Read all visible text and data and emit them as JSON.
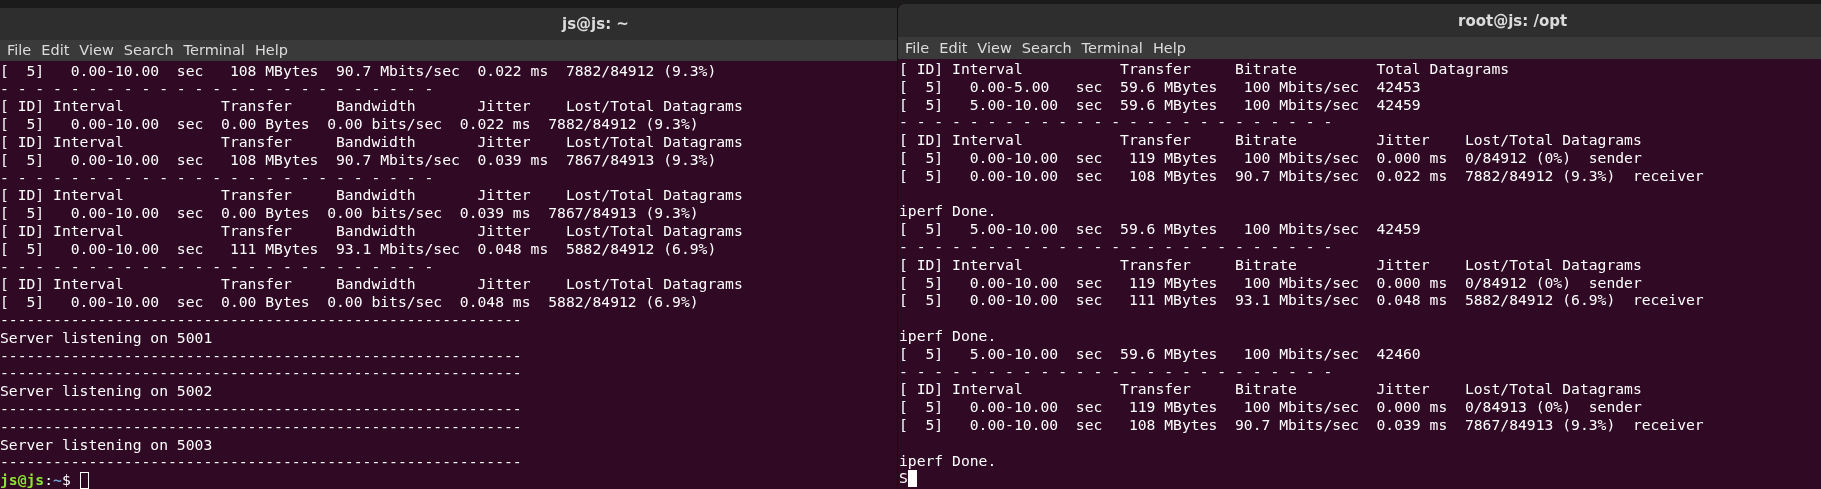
{
  "windows": [
    {
      "title": "js@js: ~",
      "menu": [
        "File",
        "Edit",
        "View",
        "Search",
        "Terminal",
        "Help"
      ],
      "lines": [
        {
          "kind": "text",
          "text": "[  5]   0.00-10.00  sec   108 MBytes  90.7 Mbits/sec  0.022 ms  7882/84912 (9.3%)"
        },
        {
          "kind": "text",
          "text": "- - - - - - - - - - - - - - - - - - - - - - - - -"
        },
        {
          "kind": "text",
          "text": "[ ID] Interval           Transfer     Bandwidth       Jitter    Lost/Total Datagrams"
        },
        {
          "kind": "text",
          "text": "[  5]   0.00-10.00  sec  0.00 Bytes  0.00 bits/sec  0.022 ms  7882/84912 (9.3%)"
        },
        {
          "kind": "text",
          "text": "[ ID] Interval           Transfer     Bandwidth       Jitter    Lost/Total Datagrams"
        },
        {
          "kind": "text",
          "text": "[  5]   0.00-10.00  sec   108 MBytes  90.7 Mbits/sec  0.039 ms  7867/84913 (9.3%)"
        },
        {
          "kind": "text",
          "text": "- - - - - - - - - - - - - - - - - - - - - - - - -"
        },
        {
          "kind": "text",
          "text": "[ ID] Interval           Transfer     Bandwidth       Jitter    Lost/Total Datagrams"
        },
        {
          "kind": "text",
          "text": "[  5]   0.00-10.00  sec  0.00 Bytes  0.00 bits/sec  0.039 ms  7867/84913 (9.3%)"
        },
        {
          "kind": "text",
          "text": "[ ID] Interval           Transfer     Bandwidth       Jitter    Lost/Total Datagrams"
        },
        {
          "kind": "text",
          "text": "[  5]   0.00-10.00  sec   111 MBytes  93.1 Mbits/sec  0.048 ms  5882/84912 (6.9%)"
        },
        {
          "kind": "text",
          "text": "- - - - - - - - - - - - - - - - - - - - - - - - -"
        },
        {
          "kind": "text",
          "text": "[ ID] Interval           Transfer     Bandwidth       Jitter    Lost/Total Datagrams"
        },
        {
          "kind": "text",
          "text": "[  5]   0.00-10.00  sec  0.00 Bytes  0.00 bits/sec  0.048 ms  5882/84912 (6.9%)"
        },
        {
          "kind": "text",
          "text": "-----------------------------------------------------------"
        },
        {
          "kind": "text",
          "text": "Server listening on 5001"
        },
        {
          "kind": "text",
          "text": "-----------------------------------------------------------"
        },
        {
          "kind": "text",
          "text": "-----------------------------------------------------------"
        },
        {
          "kind": "text",
          "text": "Server listening on 5002"
        },
        {
          "kind": "text",
          "text": "-----------------------------------------------------------"
        },
        {
          "kind": "text",
          "text": "-----------------------------------------------------------"
        },
        {
          "kind": "text",
          "text": "Server listening on 5003"
        },
        {
          "kind": "text",
          "text": "-----------------------------------------------------------"
        },
        {
          "kind": "prompt",
          "user_host": "js@js",
          "separator": ":",
          "path": "~",
          "symbol": "$",
          "cursor_focused": false
        }
      ]
    },
    {
      "title": "root@js: /opt",
      "menu": [
        "File",
        "Edit",
        "View",
        "Search",
        "Terminal",
        "Help"
      ],
      "lines": [
        {
          "kind": "text",
          "text": "[ ID] Interval           Transfer     Bitrate         Total Datagrams"
        },
        {
          "kind": "text",
          "text": "[  5]   0.00-5.00   sec  59.6 MBytes   100 Mbits/sec  42453"
        },
        {
          "kind": "text",
          "text": "[  5]   5.00-10.00  sec  59.6 MBytes   100 Mbits/sec  42459"
        },
        {
          "kind": "text",
          "text": "- - - - - - - - - - - - - - - - - - - - - - - - -"
        },
        {
          "kind": "text",
          "text": "[ ID] Interval           Transfer     Bitrate         Jitter    Lost/Total Datagrams"
        },
        {
          "kind": "text",
          "text": "[  5]   0.00-10.00  sec   119 MBytes   100 Mbits/sec  0.000 ms  0/84912 (0%)  sender"
        },
        {
          "kind": "text",
          "text": "[  5]   0.00-10.00  sec   108 MBytes  90.7 Mbits/sec  0.022 ms  7882/84912 (9.3%)  receiver"
        },
        {
          "kind": "blank"
        },
        {
          "kind": "text",
          "text": "iperf Done."
        },
        {
          "kind": "text",
          "text": "[  5]   5.00-10.00  sec  59.6 MBytes   100 Mbits/sec  42459"
        },
        {
          "kind": "text",
          "text": "- - - - - - - - - - - - - - - - - - - - - - - - -"
        },
        {
          "kind": "text",
          "text": "[ ID] Interval           Transfer     Bitrate         Jitter    Lost/Total Datagrams"
        },
        {
          "kind": "text",
          "text": "[  5]   0.00-10.00  sec   119 MBytes   100 Mbits/sec  0.000 ms  0/84912 (0%)  sender"
        },
        {
          "kind": "text",
          "text": "[  5]   0.00-10.00  sec   111 MBytes  93.1 Mbits/sec  0.048 ms  5882/84912 (6.9%)  receiver"
        },
        {
          "kind": "blank"
        },
        {
          "kind": "text",
          "text": "iperf Done."
        },
        {
          "kind": "text",
          "text": "[  5]   5.00-10.00  sec  59.6 MBytes   100 Mbits/sec  42460"
        },
        {
          "kind": "text",
          "text": "- - - - - - - - - - - - - - - - - - - - - - - - -"
        },
        {
          "kind": "text",
          "text": "[ ID] Interval           Transfer     Bitrate         Jitter    Lost/Total Datagrams"
        },
        {
          "kind": "text",
          "text": "[  5]   0.00-10.00  sec   119 MBytes   100 Mbits/sec  0.000 ms  0/84913 (0%)  sender"
        },
        {
          "kind": "text",
          "text": "[  5]   0.00-10.00  sec   108 MBytes  90.7 Mbits/sec  0.039 ms  7867/84913 (9.3%)  receiver"
        },
        {
          "kind": "blank"
        },
        {
          "kind": "text",
          "text": "iperf Done."
        },
        {
          "kind": "input",
          "text": "S",
          "cursor_focused": true
        }
      ]
    }
  ]
}
